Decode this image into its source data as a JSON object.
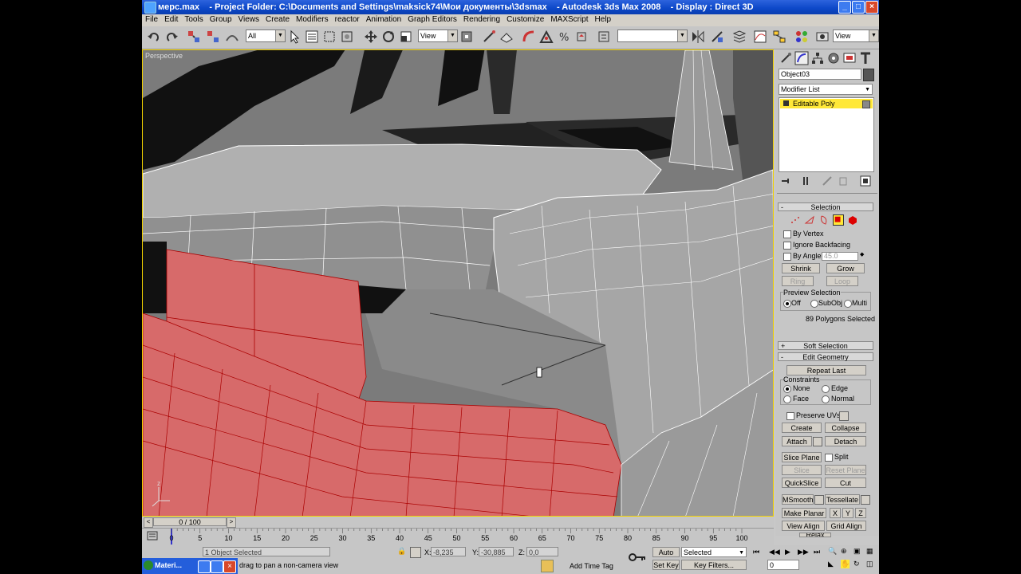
{
  "window": {
    "title": "мерс.max    - Project Folder: C:\\Documents and Settings\\maksick74\\Мои документы\\3dsmax    - Autodesk 3ds Max 2008    - Display : Direct 3D",
    "min": "_",
    "max": "□",
    "close": "×"
  },
  "menu": [
    "File",
    "Edit",
    "Tools",
    "Group",
    "Views",
    "Create",
    "Modifiers",
    "reactor",
    "Animation",
    "Graph Editors",
    "Rendering",
    "Customize",
    "MAXScript",
    "Help"
  ],
  "toolbar": {
    "selection_filter": "All",
    "ref_coord": "View",
    "named_sel": "",
    "view_right": "View"
  },
  "viewport": {
    "label": "Perspective"
  },
  "panel": {
    "object_name": "Object03",
    "modifier_list": "Modifier List",
    "stack_item": "Editable Poly",
    "selection_header": "Selection",
    "by_vertex": "By Vertex",
    "ignore_backfacing": "Ignore Backfacing",
    "by_angle": "By Angle:",
    "angle_value": "45.0",
    "shrink": "Shrink",
    "grow": "Grow",
    "ring": "Ring",
    "loop": "Loop",
    "preview_selection": "Preview Selection",
    "off": "Off",
    "subobj": "SubObj",
    "multi": "Multi",
    "polys_selected": "89 Polygons Selected",
    "soft_selection": "Soft Selection",
    "edit_geometry": "Edit Geometry",
    "repeat_last": "Repeat Last",
    "constraints": "Constraints",
    "none": "None",
    "edge": "Edge",
    "face": "Face",
    "normal": "Normal",
    "preserve_uvs": "Preserve UVs",
    "create": "Create",
    "collapse": "Collapse",
    "attach": "Attach",
    "detach": "Detach",
    "slice_plane": "Slice Plane",
    "split": "Split",
    "slice": "Slice",
    "reset_plane": "Reset Plane",
    "quickslice": "QuickSlice",
    "cut": "Cut",
    "msmooth": "MSmooth",
    "tessellate": "Tessellate",
    "make_planar": "Make Planar",
    "x": "X",
    "y": "Y",
    "z": "Z",
    "view_align": "View Align",
    "grid_align": "Grid Align",
    "relax": "Relax"
  },
  "timeline": {
    "frame": "0 / 100",
    "ticks": [
      "0",
      "5",
      "10",
      "15",
      "20",
      "25",
      "30",
      "35",
      "40",
      "45",
      "50",
      "55",
      "60",
      "65",
      "70",
      "75",
      "80",
      "85",
      "90",
      "95",
      "100"
    ]
  },
  "status": {
    "objects": "1 Object Selected",
    "hint": "drag to pan a non-camera view",
    "x_label": "X:",
    "x": "-8,235",
    "y_label": "Y:",
    "y": "-30,885",
    "z_label": "Z:",
    "z": "0,0",
    "add_time_tag": "Add Time Tag",
    "auto_key": "Auto Key",
    "selected": "Selected",
    "set_key": "Set Key",
    "key_filters": "Key Filters...",
    "frame_field": "0"
  },
  "taskbar": {
    "item": "Materi..."
  },
  "colors": {
    "selection_red": "#d76a6a",
    "title_blue": "#0c47c7",
    "stack_yellow": "#ffe838"
  }
}
